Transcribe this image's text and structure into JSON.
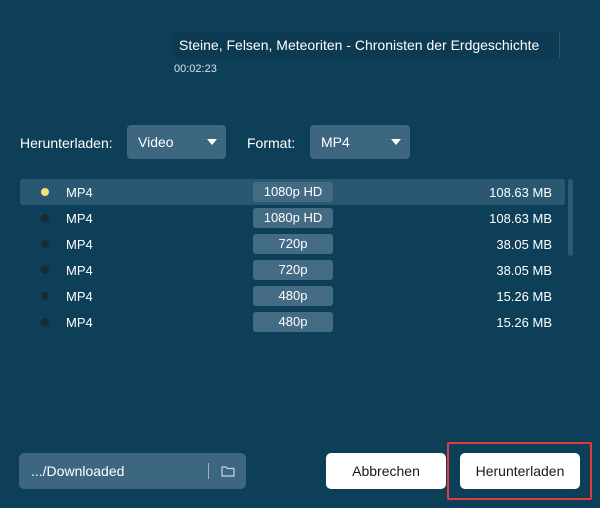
{
  "video": {
    "title": "Steine, Felsen, Meteoriten - Chronisten der Erdgeschichte",
    "duration": "00:02:23"
  },
  "options": {
    "download_label": "Herunterladen:",
    "download_value": "Video",
    "format_label": "Format:",
    "format_value": "MP4"
  },
  "formats": [
    {
      "format": "MP4",
      "resolution": "1080p HD",
      "size": "108.63 MB",
      "selected": true
    },
    {
      "format": "MP4",
      "resolution": "1080p HD",
      "size": "108.63 MB",
      "selected": false
    },
    {
      "format": "MP4",
      "resolution": "720p",
      "size": "38.05 MB",
      "selected": false
    },
    {
      "format": "MP4",
      "resolution": "720p",
      "size": "38.05 MB",
      "selected": false
    },
    {
      "format": "MP4",
      "resolution": "480p",
      "size": "15.26 MB",
      "selected": false
    },
    {
      "format": "MP4",
      "resolution": "480p",
      "size": "15.26 MB",
      "selected": false
    }
  ],
  "footer": {
    "path": ".../Downloaded",
    "folder_icon": "folder-icon",
    "cancel_label": "Abbrechen",
    "download_label": "Herunterladen"
  },
  "colors": {
    "background": "#0e3f58",
    "control": "#3d6680",
    "selected_dot": "#f6e27a",
    "highlight": "#e23b3b"
  }
}
